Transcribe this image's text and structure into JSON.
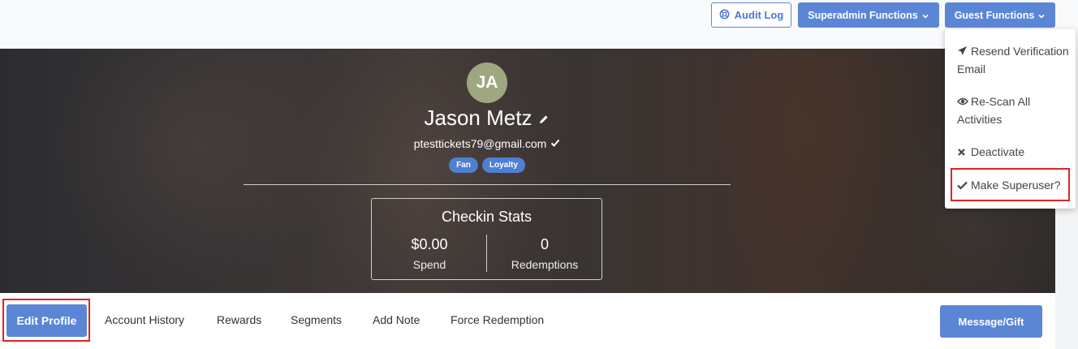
{
  "header": {
    "audit_log_label": "Audit Log",
    "superadmin_label": "Superadmin Functions",
    "guest_label": "Guest Functions"
  },
  "guest_menu": {
    "items": [
      {
        "icon": "paper-plane-icon",
        "label": "Resend Verification Email"
      },
      {
        "icon": "eye-icon",
        "label": "Re-Scan All Activities"
      },
      {
        "icon": "x-icon",
        "label": "Deactivate"
      },
      {
        "icon": "check-icon",
        "label": "Make Superuser?"
      }
    ]
  },
  "profile": {
    "initials": "JA",
    "name": "Jason Metz",
    "email": "ptesttickets79@gmail.com",
    "tags": [
      "Fan",
      "Loyalty"
    ],
    "avatar_color": "#9ea780"
  },
  "stats": {
    "title": "Checkin Stats",
    "spend_value": "$0.00",
    "spend_label": "Spend",
    "redemptions_value": "0",
    "redemptions_label": "Redemptions"
  },
  "nav": {
    "edit_profile": "Edit Profile",
    "account_history": "Account History",
    "rewards": "Rewards",
    "segments": "Segments",
    "add_note": "Add Note",
    "force_redemption": "Force Redemption",
    "message_gift": "Message/Gift"
  },
  "colors": {
    "accent": "#5b86d6",
    "tag": "#4f7fd3",
    "highlight": "#e02424"
  }
}
